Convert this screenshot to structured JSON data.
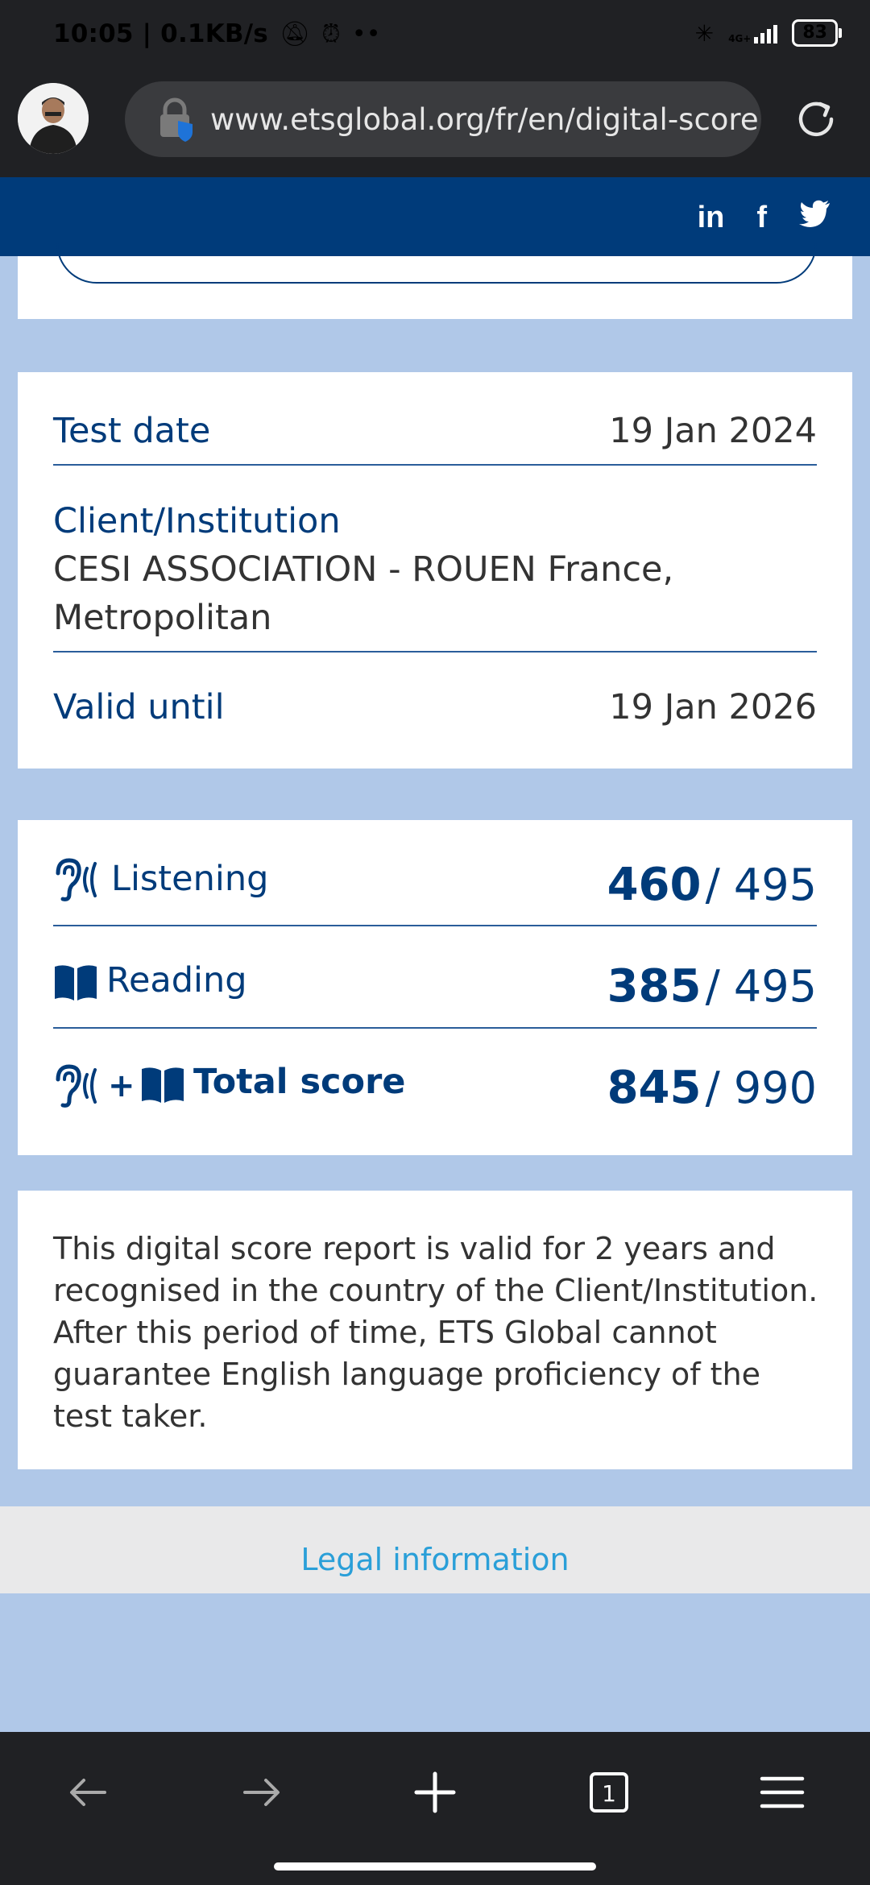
{
  "status_bar": {
    "time_speed": "10:05 | 0.1KB/s",
    "network": "4G+",
    "battery": "83"
  },
  "browser": {
    "url": "www.etsglobal.org/fr/en/digital-score-"
  },
  "test_info": {
    "test_date_label": "Test date",
    "test_date_value": "19 Jan 2024",
    "client_label": "Client/Institution",
    "client_value_line1": "CESI ASSOCIATION - ROUEN France,",
    "client_value_line2": "Metropolitan",
    "valid_until_label": "Valid until",
    "valid_until_value": "19 Jan 2026"
  },
  "scores": {
    "listening": {
      "label": "Listening",
      "score": "460",
      "max": "/ 495"
    },
    "reading": {
      "label": "Reading",
      "score": "385",
      "max": "/ 495"
    },
    "total": {
      "label": "Total score",
      "plus": "+",
      "score": "845",
      "max": "/ 990"
    }
  },
  "note": "This digital score report is valid for 2 years and recognised in the country of the Client/Institution. After this period of time, ETS Global cannot guarantee English language proficiency of the test taker.",
  "footer": {
    "legal_link": "Legal information"
  },
  "social": {
    "linkedin": "in",
    "facebook": "f"
  },
  "colors": {
    "brand_blue": "#003b7a",
    "link_blue": "#2a9fd8"
  }
}
